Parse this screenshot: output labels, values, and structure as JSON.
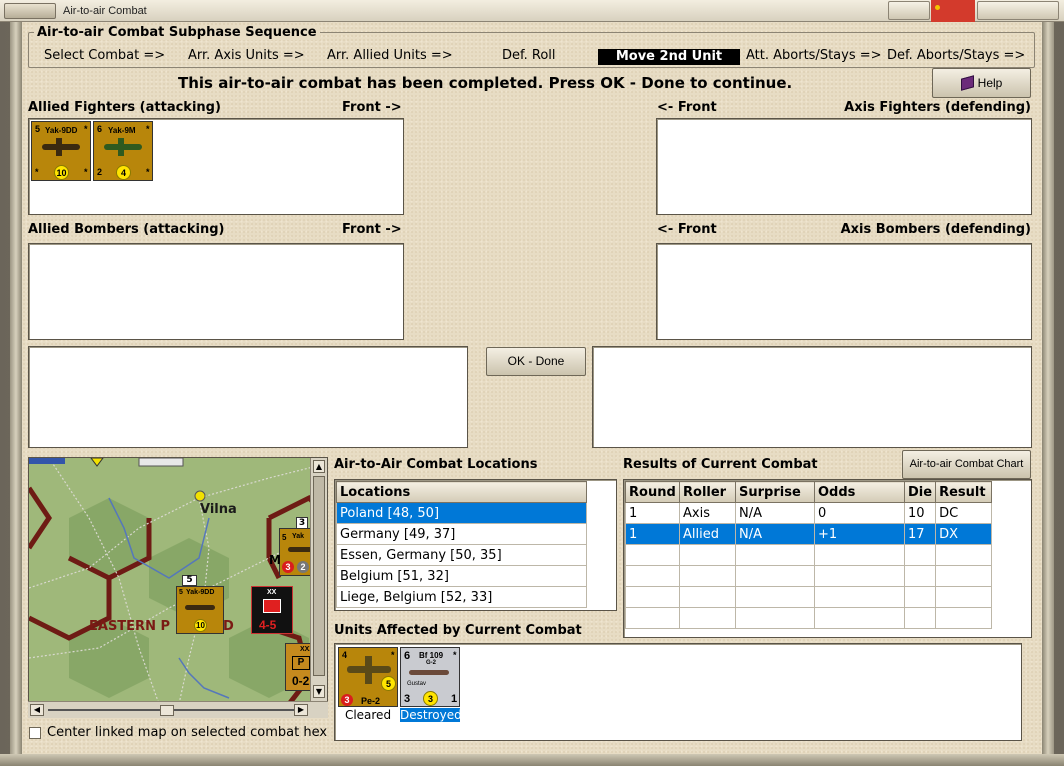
{
  "window": {
    "title": "Air-to-air Combat"
  },
  "subphase": {
    "title": "Air-to-air Combat Subphase Sequence",
    "steps": [
      "Select Combat =>",
      "Arr. Axis Units =>",
      "Arr. Allied Units =>",
      "Def. Roll",
      "Move 2nd Unit",
      "Att. Aborts/Stays =>",
      "Def. Aborts/Stays =>"
    ],
    "active_step": "Move 2nd Unit"
  },
  "status_message": "This air-to-air combat has been completed.  Press OK - Done to continue.",
  "help_button": "Help",
  "panels": {
    "allied_fighters": {
      "label": "Allied Fighters (attacking)",
      "front": "Front ->"
    },
    "axis_fighters": {
      "label": "Axis Fighters (defending)",
      "front": "<- Front"
    },
    "allied_bombers": {
      "label": "Allied Bombers (attacking)",
      "front": "Front ->"
    },
    "axis_bombers": {
      "label": "Axis Bombers (defending)",
      "front": "<- Front"
    }
  },
  "allied_fighter_units": [
    {
      "name": "Yak-9DD",
      "top_left": "5",
      "top_right": "*",
      "bottom_left": "*",
      "bottom_right": "*",
      "circle": "10",
      "color": "#b8860b"
    },
    {
      "name": "Yak-9M",
      "top_left": "6",
      "top_right": "*",
      "bottom_left": "2",
      "bottom_right": "*",
      "circle": "4",
      "color": "#b8860b"
    }
  ],
  "ok_button": "OK - Done",
  "map": {
    "city": "Vilna",
    "region": "EASTERN P",
    "region_tail": "D",
    "unit_yak_label": "Yak-9DD",
    "unit_yak_top": "5",
    "unit_yak_stack": "5",
    "unit_yak_circle": "10",
    "unit_tank_size": "XX",
    "unit_tank_strength": "4-5",
    "unit_right_top": "5",
    "unit_right_top_box": "3",
    "unit_right_name": "Yak",
    "unit_right_letter": "M",
    "unit_right_red": "3",
    "unit_right_gray": "2",
    "unit_bottom_size": "XXX",
    "unit_bottom_letter": "P",
    "unit_bottom_strength": "0-2",
    "center_checkbox_label": "Center linked map on selected combat hex",
    "center_checked": false
  },
  "locations": {
    "title": "Air-to-Air Combat Locations",
    "header": "Locations",
    "items": [
      "Poland [48, 50]",
      "Germany [49, 37]",
      "Essen, Germany [50, 35]",
      "Belgium [51, 32]",
      "Liege, Belgium [52, 33]"
    ],
    "selected_index": 0
  },
  "results": {
    "title": "Results of Current Combat",
    "chart_button": "Air-to-air Combat Chart",
    "columns": [
      "Round",
      "Roller",
      "Surprise",
      "Odds",
      "Die",
      "Result"
    ],
    "rows": [
      [
        "1",
        "Axis",
        "N/A",
        "0",
        "10",
        "DC"
      ],
      [
        "1",
        "Allied",
        "N/A",
        "+1",
        "17",
        "DX"
      ]
    ],
    "selected_index": 1
  },
  "affected": {
    "title": "Units Affected by Current Combat",
    "units": [
      {
        "name": "Pe-2",
        "top_left": "4",
        "top_right": "*",
        "red": "3",
        "circle": "5",
        "status": "Cleared"
      },
      {
        "name": "Bf 109",
        "sub": "G-2",
        "caption": "Gustav",
        "top_left": "6",
        "top_right": "*",
        "bottom_left": "3",
        "circle": "3",
        "bottom_right": "1",
        "status": "Destroyed"
      }
    ]
  }
}
